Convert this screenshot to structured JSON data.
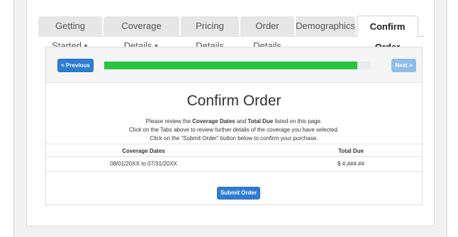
{
  "tabs": [
    {
      "label": "Getting Started",
      "dropdown": true
    },
    {
      "label": "Coverage Details",
      "dropdown": true
    },
    {
      "label": "Pricing Details",
      "dropdown": false
    },
    {
      "label": "Order Details",
      "dropdown": false
    },
    {
      "label": "Demographics",
      "dropdown": false
    },
    {
      "label": "Confirm Order",
      "dropdown": false,
      "active": true
    }
  ],
  "caret_glyph": "▼",
  "progress": {
    "previous_label": "< Previous",
    "next_label": "Next >",
    "fraction": 0.95,
    "fill_color": "#27c43f"
  },
  "page": {
    "title": "Confirm Order",
    "msg1_pre": "Please review the ",
    "msg1_b1": "Coverage Dates",
    "msg1_mid": " and ",
    "msg1_b2": "Total Due",
    "msg1_post": " listed on this page.",
    "msg2": "Click on the Tabs above to review further details of the coverage you have selected.",
    "msg3": "Click on the “Submit Order” button below to confirm your purchase."
  },
  "table": {
    "headers": [
      "Coverage Dates",
      "Total Due"
    ],
    "rows": [
      [
        "08/01/20XX to 07/31/20XX",
        "$ #,###.##"
      ]
    ]
  },
  "submit_label": "Submit Order",
  "colors": {
    "primary": "#2d7dd2",
    "next_disabled": "#8dbde8"
  }
}
